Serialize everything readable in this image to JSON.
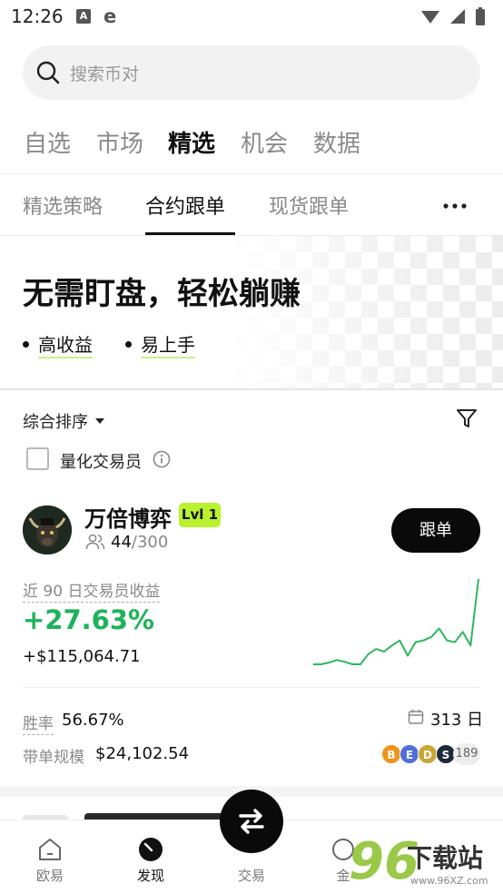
{
  "status": {
    "time": "12:26",
    "icon_a": "A",
    "icon_e": "e"
  },
  "search": {
    "placeholder": "搜索币对"
  },
  "main_tabs": [
    {
      "label": "自选"
    },
    {
      "label": "市场"
    },
    {
      "label": "精选",
      "active": true
    },
    {
      "label": "机会"
    },
    {
      "label": "数据"
    }
  ],
  "sub_tabs": [
    {
      "label": "精选策略"
    },
    {
      "label": "合约跟单",
      "active": true
    },
    {
      "label": "现货跟单"
    }
  ],
  "banner": {
    "title": "无需盯盘，轻松躺赚",
    "tags": [
      "高收益",
      "易上手"
    ]
  },
  "list": {
    "sort_label": "综合排序",
    "quant_label": "量化交易员"
  },
  "trader": {
    "name": "万倍博弈",
    "level": "Lvl 1",
    "followers": "44",
    "followers_max": "/300",
    "follow_label": "跟单",
    "roi_label": "近 90 日交易员收益",
    "roi": "+27.63%",
    "pnl": "+$115,064.71",
    "win_label": "胜率",
    "win_rate": "56.67%",
    "days": "313 日",
    "aum_label": "带单规模",
    "aum": "$24,102.54",
    "coins": [
      "B",
      "E",
      "D",
      "S"
    ],
    "coins_more": "189",
    "chart_data": {
      "type": "line",
      "values": [
        0.0,
        0.0,
        0.02,
        0.05,
        0.03,
        0.0,
        0.0,
        0.12,
        0.18,
        0.15,
        0.22,
        0.28,
        0.1,
        0.26,
        0.28,
        0.32,
        0.42,
        0.28,
        0.26,
        0.38,
        0.22,
        1.0
      ],
      "color": "#2cb85c"
    }
  },
  "nav": [
    {
      "label": "欧易",
      "icon": "home-icon"
    },
    {
      "label": "发现",
      "icon": "discover-icon",
      "active": true
    },
    {
      "label": "交易",
      "icon": "swap-icon"
    },
    {
      "label": "金",
      "icon": "earn-icon"
    }
  ],
  "watermark": {
    "brand": "下载站",
    "digits": "96",
    "url": "www.96XZ.com"
  }
}
